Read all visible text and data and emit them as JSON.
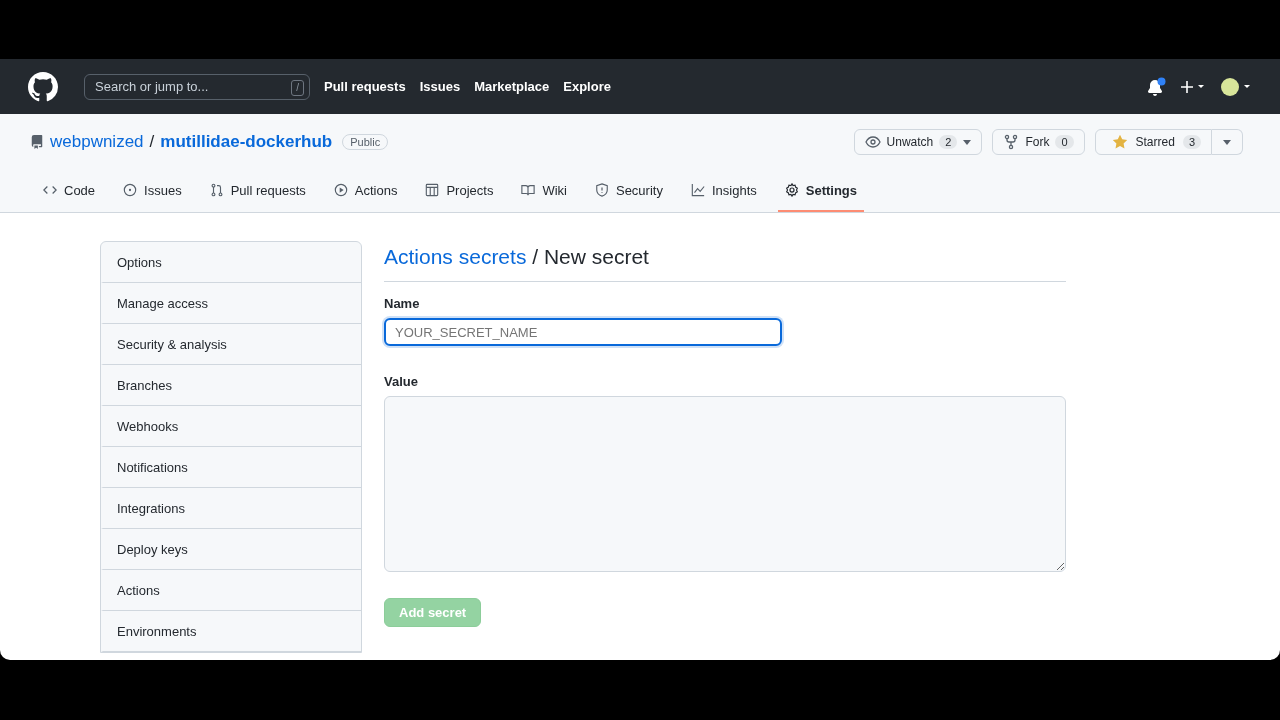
{
  "header": {
    "search": {
      "placeholder": "Search or jump to...",
      "shortcut": "/"
    },
    "links": [
      "Pull requests",
      "Issues",
      "Marketplace",
      "Explore"
    ],
    "notification_unread": true
  },
  "repo": {
    "owner": "webpwnized",
    "separator": "/",
    "name": "mutillidae-dockerhub",
    "visibility": "Public",
    "actions": [
      {
        "kind": "watch",
        "label": "Unwatch",
        "count": "2",
        "menu": true
      },
      {
        "kind": "fork",
        "label": "Fork",
        "count": "0",
        "menu": false
      },
      {
        "kind": "star",
        "label": "Starred",
        "count": "3",
        "menu": true
      }
    ]
  },
  "tabs": [
    {
      "kind": "code",
      "label": "Code",
      "selected": false
    },
    {
      "kind": "issues",
      "label": "Issues",
      "selected": false
    },
    {
      "kind": "pulls",
      "label": "Pull requests",
      "selected": false
    },
    {
      "kind": "actions",
      "label": "Actions",
      "selected": false
    },
    {
      "kind": "projects",
      "label": "Projects",
      "selected": false
    },
    {
      "kind": "wiki",
      "label": "Wiki",
      "selected": false
    },
    {
      "kind": "security",
      "label": "Security",
      "selected": false
    },
    {
      "kind": "insights",
      "label": "Insights",
      "selected": false
    },
    {
      "kind": "settings",
      "label": "Settings",
      "selected": true
    }
  ],
  "sidebar": {
    "items": [
      {
        "label": "Options",
        "selected": false
      },
      {
        "label": "Manage access",
        "selected": false
      },
      {
        "label": "Security & analysis",
        "selected": false
      },
      {
        "label": "Branches",
        "selected": false
      },
      {
        "label": "Webhooks",
        "selected": false
      },
      {
        "label": "Notifications",
        "selected": false
      },
      {
        "label": "Integrations",
        "selected": false
      },
      {
        "label": "Deploy keys",
        "selected": false
      },
      {
        "label": "Actions",
        "selected": false
      },
      {
        "label": "Environments",
        "selected": false
      }
    ]
  },
  "form": {
    "breadcrumb_link": "Actions secrets",
    "title": "/ New secret",
    "name_label": "Name",
    "name_placeholder": "YOUR_SECRET_NAME",
    "value_label": "Value",
    "submit": {
      "label": "Add secret",
      "disabled": true
    }
  }
}
